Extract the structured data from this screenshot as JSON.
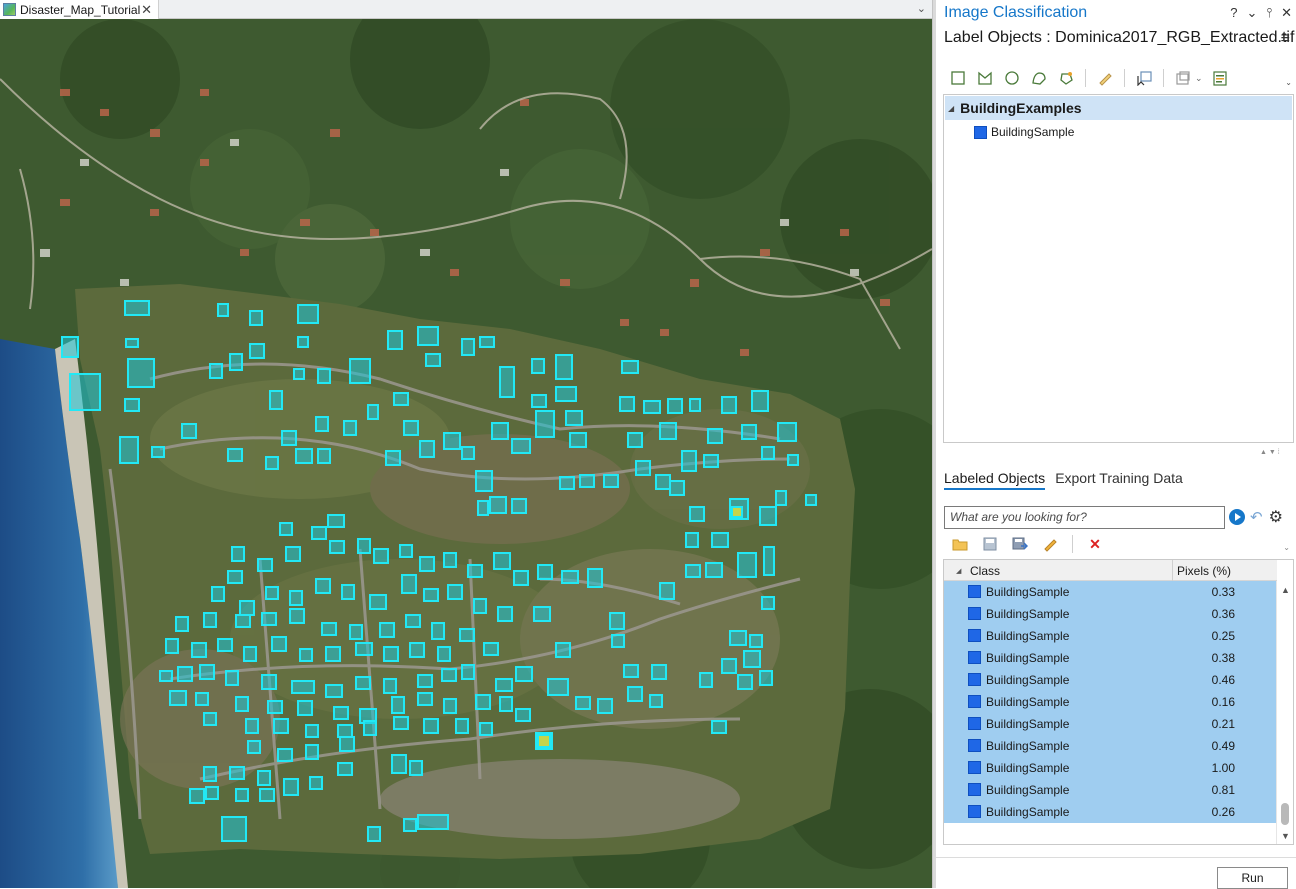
{
  "map_view": {
    "tab_label": "Disaster_Map_Tutorial",
    "tab_close": "✕",
    "tab_overflow": "⌄"
  },
  "panel": {
    "title": "Image Classification",
    "title_controls": [
      "?",
      "⌄",
      "⫯",
      "✕"
    ],
    "subtitle": "Label Objects : Dominica2017_RGB_Extracted.tif",
    "menu_icon": "≡"
  },
  "toolbar_icons": [
    "rectangle-icon",
    "polygon-icon",
    "circle-icon",
    "freehand-icon",
    "auto-detect-icon",
    "segment-picker-icon",
    "select-icon",
    "label-image-icon",
    "properties-icon"
  ],
  "schema": {
    "parent": "BuildingExamples",
    "child": "BuildingSample",
    "class_color": "#1f67e6"
  },
  "tabs": {
    "active": "Labeled Objects",
    "inactive": "Export Training Data"
  },
  "search": {
    "placeholder": "What are you looking for?"
  },
  "table": {
    "col_class": "Class",
    "col_pixels": "Pixels (%)",
    "rows": [
      {
        "class": "BuildingSample",
        "pixels": "0.33"
      },
      {
        "class": "BuildingSample",
        "pixels": "0.36"
      },
      {
        "class": "BuildingSample",
        "pixels": "0.25"
      },
      {
        "class": "BuildingSample",
        "pixels": "0.38"
      },
      {
        "class": "BuildingSample",
        "pixels": "0.46"
      },
      {
        "class": "BuildingSample",
        "pixels": "0.16"
      },
      {
        "class": "BuildingSample",
        "pixels": "0.21"
      },
      {
        "class": "BuildingSample",
        "pixels": "0.49"
      },
      {
        "class": "BuildingSample",
        "pixels": "1.00"
      },
      {
        "class": "BuildingSample",
        "pixels": "0.81"
      },
      {
        "class": "BuildingSample",
        "pixels": "0.26"
      }
    ]
  },
  "footer": {
    "run_label": "Run"
  },
  "colors": {
    "accent": "#1677c9",
    "label_outline": "#22e0ef",
    "selected_row": "#9fcdf0"
  }
}
